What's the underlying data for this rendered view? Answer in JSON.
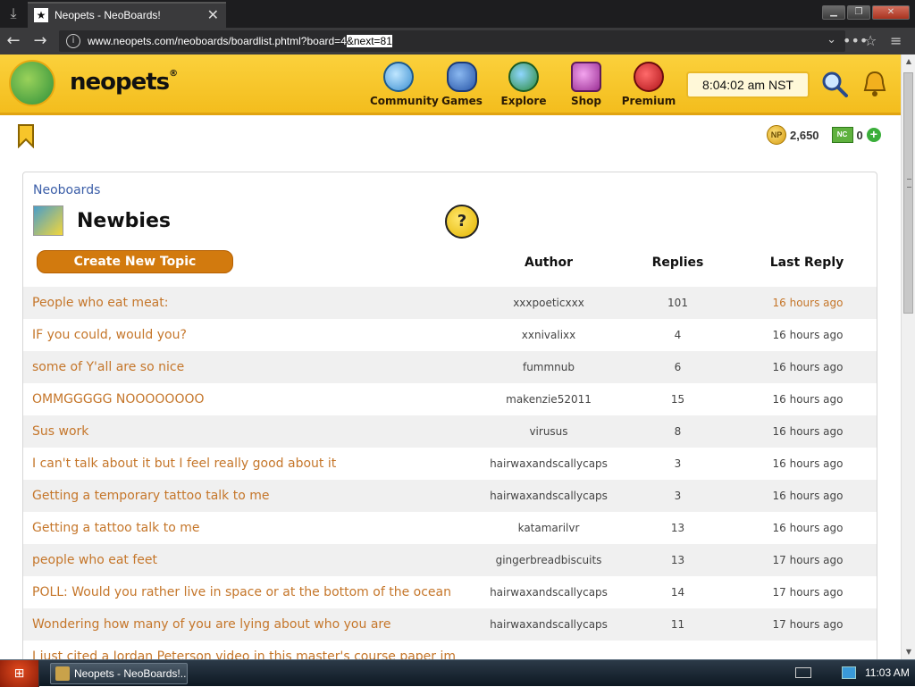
{
  "browser": {
    "tab_title": "Neopets - NeoBoards!",
    "url_main": "www.neopets.com/neoboards/boardlist.phtml?board=4",
    "url_selected": "&next=81",
    "tab_close": "✕"
  },
  "header": {
    "logo_text": "neopets",
    "nav": [
      {
        "label": "Community",
        "icon": "community-icon",
        "color": "#5fb3e8"
      },
      {
        "label": "Games",
        "icon": "games-icon",
        "color": "#3a77c9"
      },
      {
        "label": "Explore",
        "icon": "explore-icon",
        "color": "#3aa04a"
      },
      {
        "label": "Shop",
        "icon": "shop-icon",
        "color": "#c84cc0"
      },
      {
        "label": "Premium",
        "icon": "premium-icon",
        "color": "#d5262a"
      }
    ],
    "clock": "8:04:02 am NST"
  },
  "currency": {
    "neopoints": "2,650",
    "neocash": "0",
    "np_coin_label": "NP",
    "nc_label": "NC"
  },
  "board": {
    "breadcrumb": "Neoboards",
    "title": "Newbies",
    "help_label": "?",
    "create_button": "Create New Topic",
    "columns": {
      "author": "Author",
      "replies": "Replies",
      "last_reply": "Last Reply"
    },
    "topics": [
      {
        "title": "People who eat meat:",
        "author": "xxxpoeticxxx",
        "replies": "101",
        "last": "16 hours ago"
      },
      {
        "title": "IF you could, would you?",
        "author": "xxnivalixx",
        "replies": "4",
        "last": "16 hours ago"
      },
      {
        "title": "some of Y'all are so nice",
        "author": "fummnub",
        "replies": "6",
        "last": "16 hours ago"
      },
      {
        "title": "OMMGGGGG NOOOOOOOO",
        "author": "makenzie52011",
        "replies": "15",
        "last": "16 hours ago"
      },
      {
        "title": "Sus work",
        "author": "virusus",
        "replies": "8",
        "last": "16 hours ago"
      },
      {
        "title": "I can't talk about it but I feel really good about it",
        "author": "hairwaxandscallycaps",
        "replies": "3",
        "last": "16 hours ago"
      },
      {
        "title": "Getting a temporary tattoo talk to me",
        "author": "hairwaxandscallycaps",
        "replies": "3",
        "last": "16 hours ago"
      },
      {
        "title": "Getting a tattoo talk to me",
        "author": "katamarilvr",
        "replies": "13",
        "last": "16 hours ago"
      },
      {
        "title": "people who eat feet",
        "author": "gingerbreadbiscuits",
        "replies": "13",
        "last": "17 hours ago"
      },
      {
        "title": "POLL: Would you rather live in space or at the bottom of the ocean",
        "author": "hairwaxandscallycaps",
        "replies": "14",
        "last": "17 hours ago"
      },
      {
        "title": "Wondering how many of you are lying about who you are",
        "author": "hairwaxandscallycaps",
        "replies": "11",
        "last": "17 hours ago"
      },
      {
        "title": "I just cited a Jordan Peterson video in this master's course paper im",
        "author": "",
        "replies": "",
        "last": ""
      }
    ]
  },
  "taskbar": {
    "item_label": "Neopets - NeoBoards!...",
    "time": "11:03 AM"
  },
  "colors": {
    "brand_yellow": "#f7c52a",
    "topic_link": "#c5762a",
    "create_button": "#d27a0e",
    "breadcrumb": "#3b5ea8"
  }
}
